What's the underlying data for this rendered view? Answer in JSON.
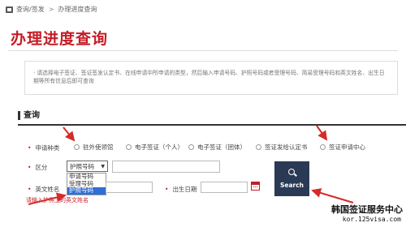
{
  "breadcrumb": {
    "items": [
      "查询/签发",
      "办理进度查询"
    ],
    "separator": ">"
  },
  "page_title": "办理进度查询",
  "notice": "· 请选择电子签证、签证签发认定书、在线申请中所申请的类型，然后输入申请号码、护照号码或者受理号码、简易受理号码和英文姓名、出生日期等所有信息后即可查询",
  "section_title": "查询",
  "form": {
    "type_label": "申请种类",
    "options": [
      "驻外使领馆",
      "电子签证（个人）",
      "电子签证（团体）",
      "签证发给认定书",
      "签证申请中心"
    ],
    "field_label": "区分",
    "select_value": "护照号码",
    "select_arrow": "▼",
    "dropdown_items": [
      "申请号码",
      "受理号码",
      "护照号码"
    ],
    "name_label": "英文姓名",
    "dob_label": "出生日期",
    "hint": "请输入护照上的英文姓名"
  },
  "search_button": "Search",
  "watermark": {
    "line1": "韩国签证服务中心",
    "line2": "kor.125visa.com"
  },
  "colors": {
    "accent": "#c41d25",
    "button": "#2a3a55",
    "selected": "#2f6fd6"
  }
}
